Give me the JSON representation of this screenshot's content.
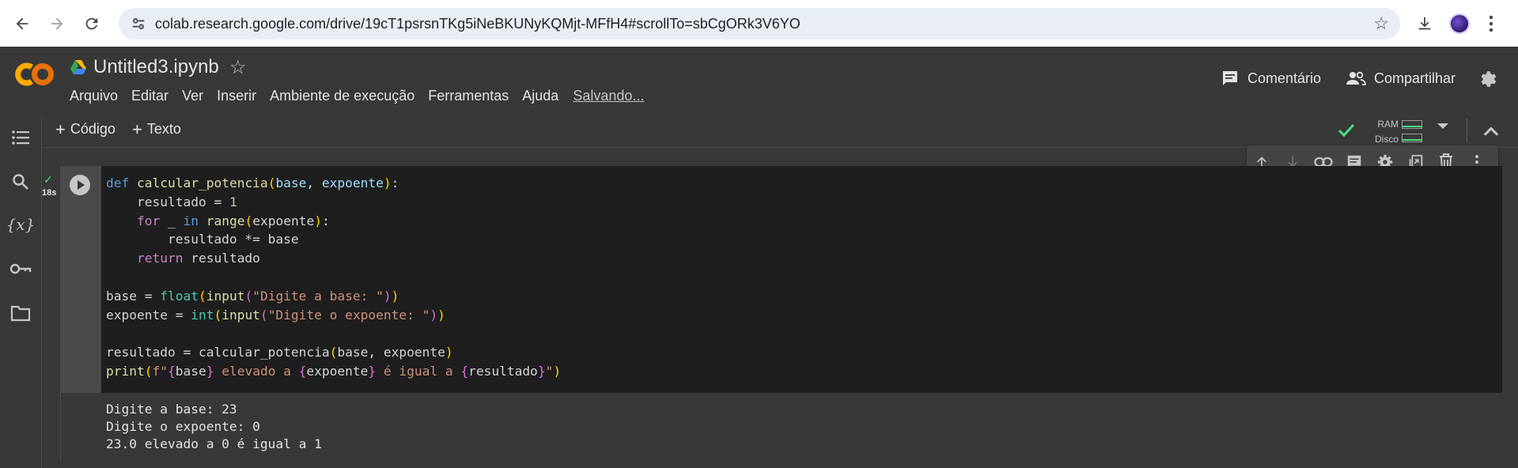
{
  "browser": {
    "url": "colab.research.google.com/drive/19cT1psrsnTKg5iNeBKUNyKQMjt-MFfH4#scrollTo=sbCgORk3V6YO",
    "back_icon": "arrow-back-icon",
    "forward_icon": "arrow-forward-icon",
    "reload_icon": "reload-icon",
    "bookmark_icon": "star-outline-icon",
    "download_icon": "download-icon",
    "menu_icon": "kebab-menu-icon"
  },
  "header": {
    "notebook_title": "Untitled3.ipynb",
    "menu": [
      "Arquivo",
      "Editar",
      "Ver",
      "Inserir",
      "Ambiente de execução",
      "Ferramentas",
      "Ajuda"
    ],
    "save_status": "Salvando...",
    "comment_label": "Comentário",
    "share_label": "Compartilhar"
  },
  "rail": {
    "items": [
      "toc-icon",
      "search-icon",
      "variables-icon",
      "secrets-key-icon",
      "folder-icon"
    ],
    "variables_glyph": "{x}"
  },
  "toolbar": {
    "add_code_label": "Código",
    "add_text_label": "Texto",
    "ram_label": "RAM",
    "disk_label": "Disco"
  },
  "cell": {
    "exec_time": "18s",
    "code_lines": [
      "def calcular_potencia(base, expoente):",
      "    resultado = 1",
      "    for _ in range(expoente):",
      "        resultado *= base",
      "    return resultado",
      "",
      "base = float(input(\"Digite a base: \"))",
      "expoente = int(input(\"Digite o expoente: \"))",
      "",
      "resultado = calcular_potencia(base, expoente)",
      "print(f\"{base} elevado a {expoente} é igual a {resultado}\")"
    ],
    "output_lines": [
      "Digite a base: 23",
      "Digite o expoente: 0",
      "23.0 elevado a 0 é igual a 1"
    ]
  },
  "cell_toolbar": [
    "move-up-icon",
    "move-down-icon",
    "link-icon",
    "comment-icon",
    "settings-icon",
    "mirror-cell-icon",
    "delete-icon",
    "more-vert-icon"
  ],
  "colors": {
    "colab_orange": "#f9ab00",
    "drive_green": "#34a853",
    "check_green": "#4ade80"
  }
}
